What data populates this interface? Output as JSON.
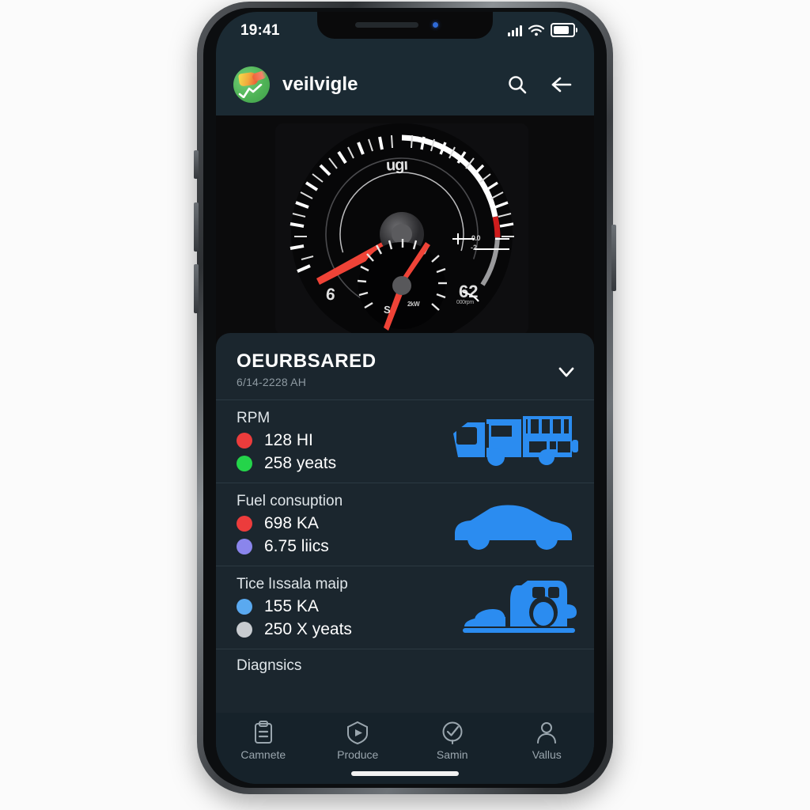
{
  "status_bar": {
    "time": "19:41",
    "icons": [
      "signal-bars-icon",
      "wifi-icon",
      "battery-icon"
    ]
  },
  "app_bar": {
    "logo_icon": "app-logo-icon",
    "title": "veilvigle",
    "search_icon": "search-icon",
    "back_icon": "back-arrow-icon"
  },
  "gauge": {
    "top_label": "ugı",
    "left_label": "6",
    "right_label": "62",
    "right_sublabel": "000rpm",
    "mid_label": "0.0",
    "mid_label2": "-2",
    "inner_left_label": "S",
    "inner_right_label": "2kW",
    "accent_needle": "#e8453c",
    "arc_color": "#ffffff",
    "redline_color": "#d11f1f"
  },
  "sheet": {
    "title": "OEURBSARED",
    "subtitle": "6/14-2228 AH",
    "collapse_icon": "chevron-down-icon",
    "metrics": [
      {
        "title": "RPM",
        "icon": "truck-icon",
        "readings": [
          {
            "color": "#ec3c3c",
            "value": "128 HI"
          },
          {
            "color": "#24d44a",
            "value": "258 yeats"
          }
        ]
      },
      {
        "title": "Fuel consuption",
        "icon": "car-icon",
        "readings": [
          {
            "color": "#ec3c3c",
            "value": "698 KA"
          },
          {
            "color": "#8a85ec",
            "value": "6.75 liics"
          }
        ]
      },
      {
        "title": "Tice lıssala maip",
        "icon": "vehicle-service-icon",
        "readings": [
          {
            "color": "#5aa9f0",
            "value": "155 KA"
          },
          {
            "color": "#c8ccd0",
            "value": "250 X yeats"
          }
        ]
      }
    ],
    "next_section_title": "Diagnsics"
  },
  "bottom_nav": {
    "items": [
      {
        "label": "Camnete",
        "icon": "clipboard-icon"
      },
      {
        "label": "Produce",
        "icon": "shield-play-icon"
      },
      {
        "label": "Samin",
        "icon": "check-circle-icon"
      },
      {
        "label": "Vallus",
        "icon": "person-icon"
      }
    ]
  },
  "colors": {
    "sheet_bg": "#1b262e",
    "appbar_bg": "#1b2a33",
    "nav_bg": "#16222a",
    "icon_blue": "#2b8cf0"
  }
}
